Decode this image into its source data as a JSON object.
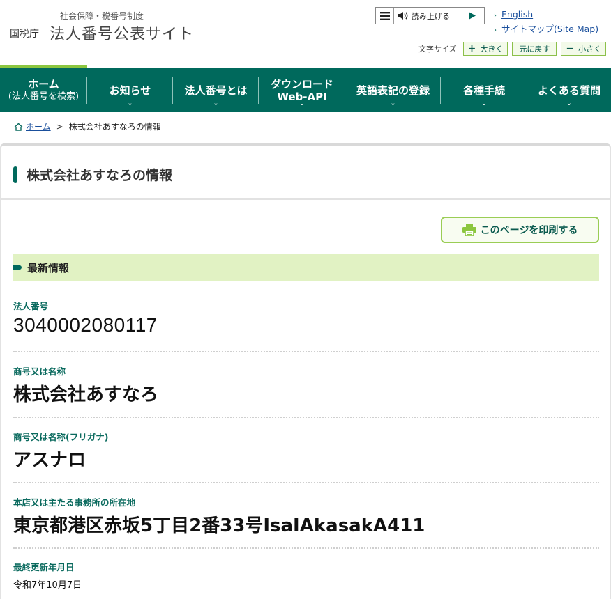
{
  "header": {
    "sub_title": "社会保障・税番号制度",
    "agency": "国税庁",
    "site_name": "法人番号公表サイト",
    "read_aloud_label": "読み上げる",
    "links": [
      {
        "label": "English"
      },
      {
        "label": "サイトマップ(Site Map)"
      }
    ],
    "font_size": {
      "label": "文字サイズ",
      "larger": "大きく",
      "reset": "元に戻す",
      "smaller": "小さく"
    }
  },
  "nav": {
    "items": [
      {
        "label": "ホーム",
        "sub": "(法人番号を検索)"
      },
      {
        "label": "お知らせ"
      },
      {
        "label": "法人番号とは"
      },
      {
        "label": "ダウンロード",
        "label2": "Web-API"
      },
      {
        "label": "英語表記の登録"
      },
      {
        "label": "各種手続"
      },
      {
        "label": "よくある質問"
      }
    ]
  },
  "breadcrumb": {
    "home": "ホーム",
    "separator": ">",
    "current": "株式会社あすなろの情報"
  },
  "main": {
    "title": "株式会社あすなろの情報",
    "print_label": "このページを印刷する",
    "section_title": "最新情報",
    "fields": [
      {
        "label": "法人番号",
        "value": "3040002080117"
      },
      {
        "label": "商号又は名称",
        "value": "株式会社あすなろ"
      },
      {
        "label": "商号又は名称(フリガナ)",
        "value": "アスナロ"
      },
      {
        "label": "本店又は主たる事務所の所在地",
        "value": "東京都港区赤坂5丁目2番33号IsaIAkasakA411"
      },
      {
        "label": "最終更新年月日",
        "value": "令和7年10月7日"
      }
    ]
  },
  "colors": {
    "nav_bg": "#00695c",
    "accent_green": "#8cc63f",
    "section_bg": "#e1f2c3",
    "link": "#1a4f9c"
  }
}
